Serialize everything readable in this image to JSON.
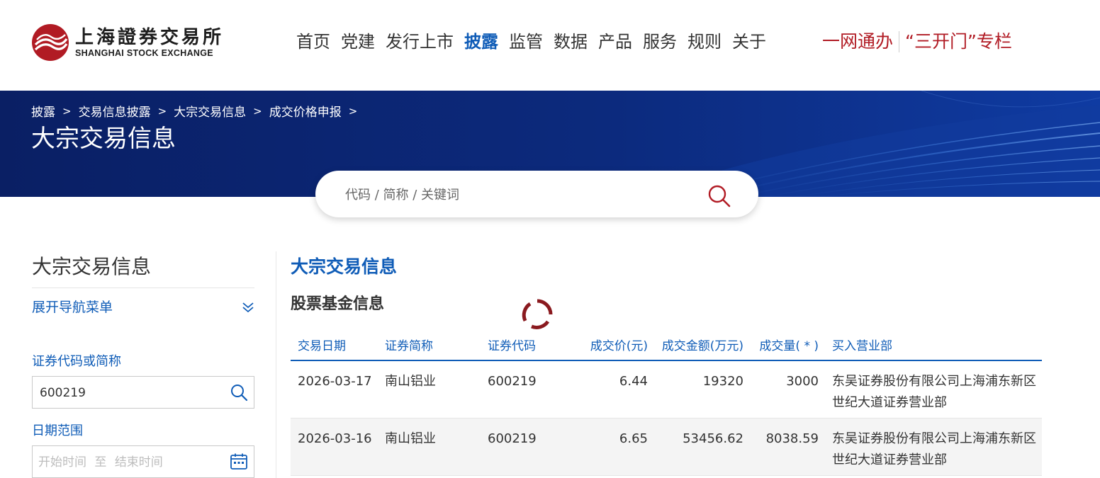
{
  "header": {
    "logo_cn": "上海證券交易所",
    "logo_en": "SHANGHAI STOCK EXCHANGE",
    "nav": [
      "首页",
      "党建",
      "发行上市",
      "披露",
      "监管",
      "数据",
      "产品",
      "服务",
      "规则",
      "关于"
    ],
    "active_nav_index": 3,
    "special_links": [
      "一网通办",
      "“三开门”专栏"
    ]
  },
  "breadcrumb": [
    "披露",
    "交易信息披露",
    "大宗交易信息",
    "成交价格申报"
  ],
  "page_title": "大宗交易信息",
  "search": {
    "placeholder": "代码 / 简称 / 关键词"
  },
  "sidebar": {
    "title": "大宗交易信息",
    "expand_label": "展开导航菜单",
    "code_label": "证券代码或简称",
    "code_value": "600219",
    "date_label": "日期范围",
    "date_start_placeholder": "开始时间",
    "date_to": "至",
    "date_end_placeholder": "结束时间"
  },
  "main": {
    "title": "大宗交易信息",
    "subtitle": "股票基金信息",
    "table": {
      "columns": [
        "交易日期",
        "证券简称",
        "证券代码",
        "成交价(元)",
        "成交金额(万元)",
        "成交量( * )",
        "买入营业部"
      ],
      "rows": [
        {
          "date": "2026-03-17",
          "name": "南山铝业",
          "code": "600219",
          "price": "6.44",
          "amount": "19320",
          "volume": "3000",
          "buyer": "东吴证券股份有限公司上海浦东新区世纪大道证券营业部"
        },
        {
          "date": "2026-03-16",
          "name": "南山铝业",
          "code": "600219",
          "price": "6.65",
          "amount": "53456.62",
          "volume": "8038.59",
          "buyer": "东吴证券股份有限公司上海浦东新区世纪大道证券营业部"
        }
      ]
    }
  },
  "colors": {
    "brand_blue": "#0f5cb7",
    "brand_red": "#b11b24",
    "banner_dark": "#0a1f64"
  }
}
